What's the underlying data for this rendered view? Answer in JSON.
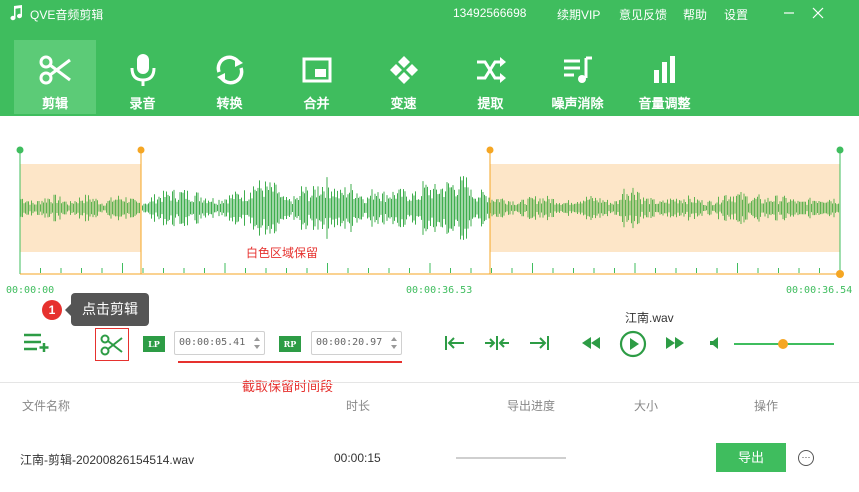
{
  "app": {
    "title": "QVE音频剪辑",
    "phone": "13492566698"
  },
  "titlebar": {
    "renew": "续期VIP",
    "feedback": "意见反馈",
    "help": "帮助",
    "settings": "设置",
    "minimize": "—",
    "close": "✕"
  },
  "tools": [
    {
      "label": "剪辑",
      "icon": "scissors-icon",
      "active": true
    },
    {
      "label": "录音",
      "icon": "microphone-icon"
    },
    {
      "label": "转换",
      "icon": "convert-icon"
    },
    {
      "label": "合并",
      "icon": "merge-icon"
    },
    {
      "label": "变速",
      "icon": "speed-icon"
    },
    {
      "label": "提取",
      "icon": "extract-icon"
    },
    {
      "label": "噪声消除",
      "icon": "denoise-icon"
    },
    {
      "label": "音量调整",
      "icon": "volume-adjust-icon"
    }
  ],
  "wave": {
    "hint": "白色区域保留",
    "time_start": "00:00:00",
    "time_mid": "00:00:36.53",
    "time_end": "00:00:36.54"
  },
  "guide": {
    "step": "1",
    "tooltip": "点击剪辑",
    "range_hint": "截取保留时间段"
  },
  "controls": {
    "lp": "LP",
    "rp": "RP",
    "lp_time": "00:00:05.41",
    "rp_time": "00:00:20.97",
    "current_file": "江南.wav",
    "volume_level": 0.5
  },
  "table": {
    "headers": {
      "name": "文件名称",
      "duration": "时长",
      "progress": "导出进度",
      "size": "大小",
      "action": "操作"
    },
    "rows": [
      {
        "name": "江南-剪辑-20200826154514.wav",
        "duration": "00:00:15",
        "progress": 0,
        "size": "",
        "export": "导出",
        "more": "···"
      }
    ]
  },
  "colors": {
    "brand": "#3fbd5e",
    "accent": "#f5a623",
    "selection": "#fde6c8",
    "wave": "#3fae4e",
    "hint": "#e6312e"
  }
}
